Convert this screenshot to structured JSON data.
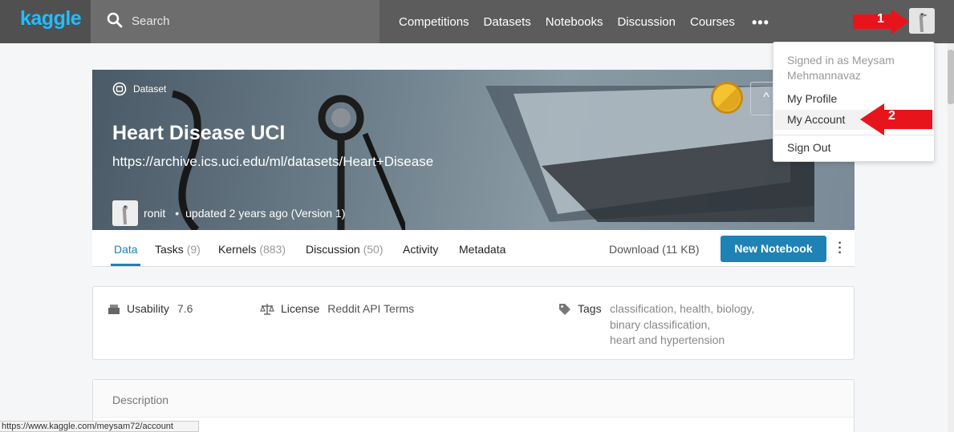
{
  "topbar": {
    "logo": "kaggle",
    "search_placeholder": "Search",
    "nav": [
      "Competitions",
      "Datasets",
      "Notebooks",
      "Discussion",
      "Courses"
    ],
    "more": "•••"
  },
  "hero": {
    "label": "Dataset",
    "title": "Heart Disease UCI",
    "subtitle": "https://archive.ics.uci.edu/ml/datasets/Heart+Disease",
    "owner": "ronit",
    "updated": "updated 2 years ago (Version 1)",
    "bullet": "•",
    "vote_icon": "^"
  },
  "tabs": [
    {
      "label": "Data",
      "count": ""
    },
    {
      "label": "Tasks",
      "count": "(9)"
    },
    {
      "label": "Kernels",
      "count": "(883)"
    },
    {
      "label": "Discussion",
      "count": "(50)"
    },
    {
      "label": "Activity",
      "count": ""
    },
    {
      "label": "Metadata",
      "count": ""
    }
  ],
  "actions": {
    "download": "Download (11 KB)",
    "new_notebook": "New Notebook"
  },
  "meta": {
    "usability_label": "Usability",
    "usability_value": "7.6",
    "license_label": "License",
    "license_value": "Reddit API Terms",
    "tags_label": "Tags",
    "tags_line1": "classification, health, biology,",
    "tags_line2": "binary classification,",
    "tags_line3": "heart and hypertension"
  },
  "description": {
    "heading": "Description"
  },
  "dropdown": {
    "signed_in": "Signed in as Meysam Mehmannavaz",
    "my_profile": "My Profile",
    "my_account": "My Account",
    "sign_out": "Sign Out"
  },
  "annotations": {
    "arrow1": "1",
    "arrow2": "2"
  },
  "statusbar": {
    "url": "https://www.kaggle.com/meysam72/account"
  },
  "colors": {
    "accent": "#1e82b4",
    "logo": "#20beff",
    "annotation": "#e8141c"
  }
}
